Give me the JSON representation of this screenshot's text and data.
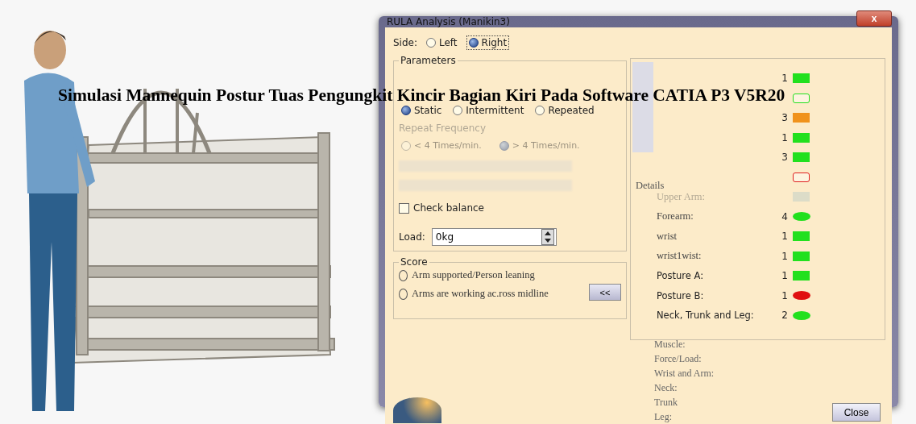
{
  "caption": "Simulasi Mannequin Postur Tuas Pengungkit Kincir Bagian Kiri Pada Software CATIA P3 V5R20",
  "window": {
    "title": "RULA Analysis (Manikin3)",
    "close_label": "x"
  },
  "side": {
    "label": "Side:",
    "options": [
      {
        "label": "Left",
        "selected": false
      },
      {
        "label": "Right",
        "selected": true
      }
    ]
  },
  "parameters": {
    "title": "Parameters",
    "mode_options": [
      {
        "label": "Static",
        "selected": true
      },
      {
        "label": "Intermittent",
        "selected": false
      },
      {
        "label": "Repeated",
        "selected": false
      }
    ],
    "repeat_frequency": {
      "label": "Repeat Frequency",
      "disabled": true,
      "options": [
        {
          "label": "< 4 Times/min.",
          "selected": false
        },
        {
          "label": "> 4 Times/min.",
          "selected": true
        }
      ]
    },
    "check_balance": {
      "label": "Check balance",
      "checked": false
    },
    "load": {
      "label": "Load:",
      "value": "0kg"
    }
  },
  "score": {
    "title": "Score",
    "options": [
      {
        "label": "Arm supported/Person leaning",
        "selected": false
      },
      {
        "label": "Arms are working ac.ross midline",
        "selected": false
      }
    ],
    "toggle_label": "<<"
  },
  "score_rows": [
    {
      "label": "",
      "score": "1",
      "color": "#22e01e",
      "kind": "rect",
      "faded": false
    },
    {
      "label": "",
      "score": "",
      "color": "#22e01e",
      "kind": "outline",
      "faded": true
    },
    {
      "label": "",
      "score": "3",
      "color": "#f0921c",
      "kind": "rect",
      "faded": false
    },
    {
      "label": "",
      "score": "1",
      "color": "#22e01e",
      "kind": "rect",
      "faded": false
    },
    {
      "label": "",
      "score": "3",
      "color": "#22e01e",
      "kind": "rect",
      "faded": false
    },
    {
      "label": "",
      "score": "",
      "color": "#e02020",
      "kind": "outline",
      "faded": true
    },
    {
      "label": "Upper Arm:",
      "score": "",
      "color": "#dcdcc8",
      "kind": "rect",
      "faded": true
    },
    {
      "label": "Forearm:",
      "score": "4",
      "color": "#22e01e",
      "kind": "ellipse",
      "faded": false
    },
    {
      "label": "wrist",
      "score": "1",
      "color": "#22e01e",
      "kind": "rect",
      "faded": false
    },
    {
      "label": "wrist1wist:",
      "score": "1",
      "color": "#22e01e",
      "kind": "rect",
      "faded": false
    },
    {
      "label": "Posture A:",
      "score": "1",
      "color": "#22e01e",
      "kind": "rect",
      "faded": false
    },
    {
      "label": "Posture B:",
      "score": "1",
      "color": "#e01010",
      "kind": "ellipse",
      "faded": false
    },
    {
      "label": "Neck, Trunk and Leg:",
      "score": "2",
      "color": "#22e01e",
      "kind": "ellipse",
      "faded": false
    }
  ],
  "details": {
    "title": "Details",
    "extra_lines": [
      "Muscle:",
      "Force/Load:",
      "Wrist and Arm:",
      "Neck:",
      "Trunk",
      "Leg:"
    ]
  },
  "close_button": "Close"
}
